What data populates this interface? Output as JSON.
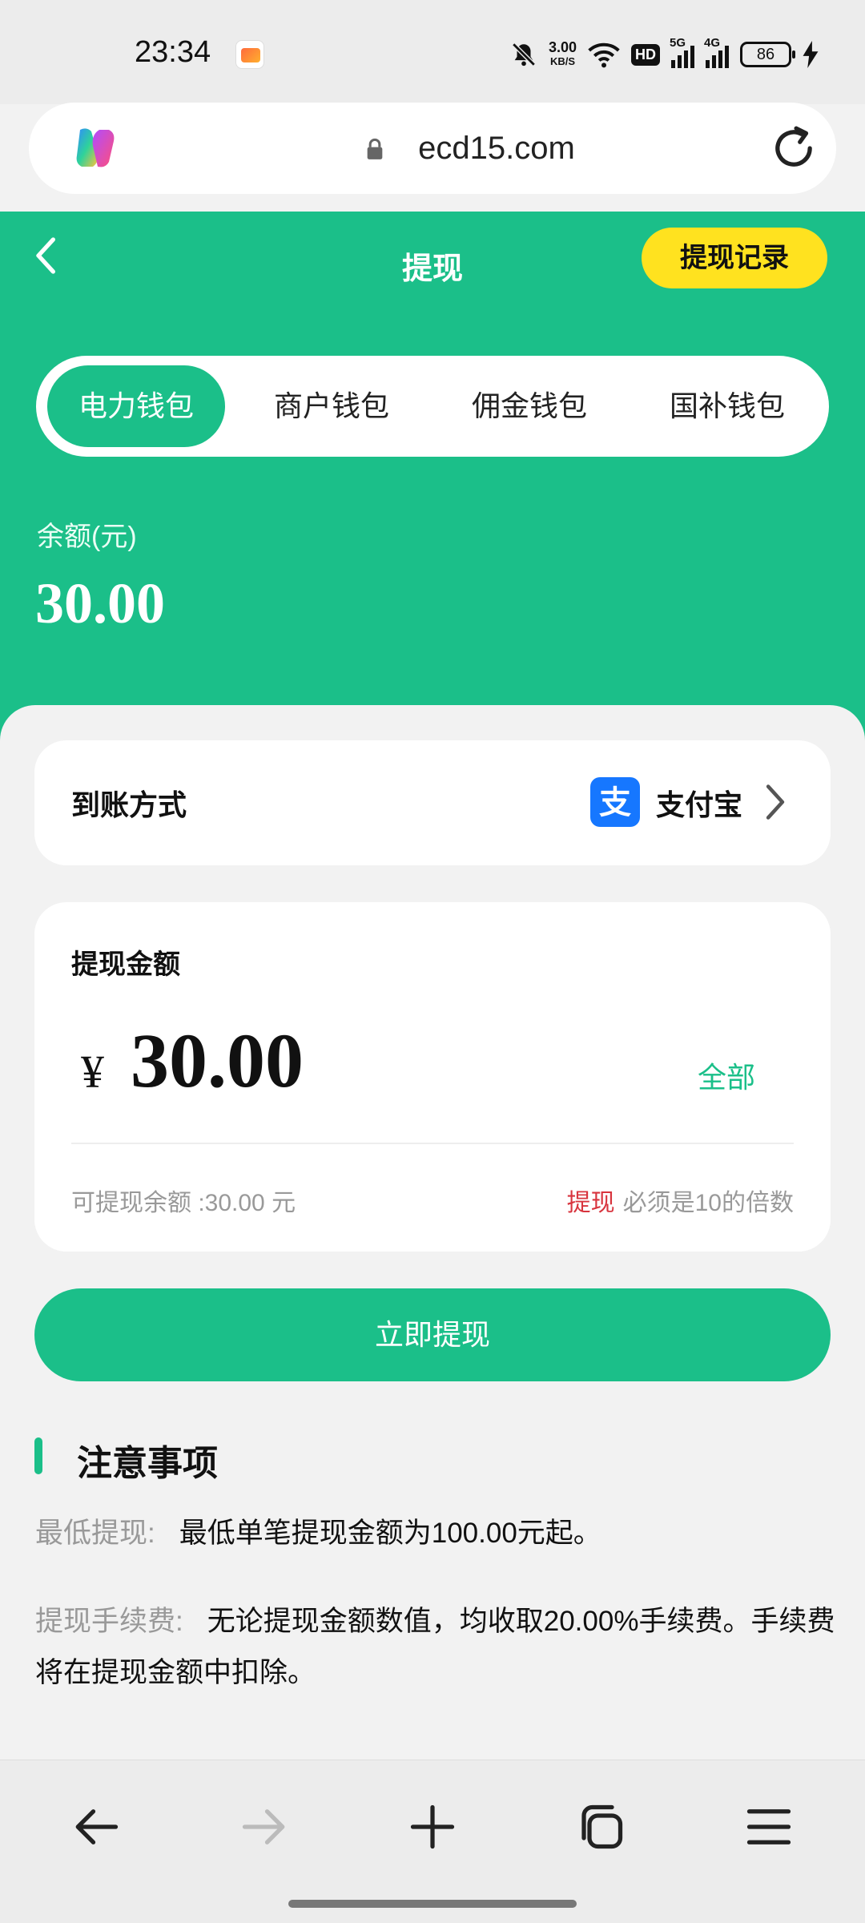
{
  "status_bar": {
    "time": "23:34",
    "net_speed_value": "3.00",
    "net_speed_unit": "KB/S",
    "hd_label": "HD",
    "signal_1": "5G",
    "signal_2": "4G",
    "battery": "86",
    "icons": [
      "bell-muted-icon",
      "wifi-icon",
      "hd-icon",
      "signal-5g-icon",
      "signal-4g-icon",
      "battery-icon",
      "charging-icon"
    ]
  },
  "browser": {
    "url": "ecd15.com",
    "toolbar_icons": [
      "back-arrow-icon",
      "forward-arrow-icon",
      "new-tab-plus-icon",
      "tabs-icon",
      "menu-icon"
    ]
  },
  "header": {
    "title": "提现",
    "record_button": "提现记录",
    "tabs": [
      {
        "label": "电力钱包",
        "active": true
      },
      {
        "label": "商户钱包",
        "active": false
      },
      {
        "label": "佣金钱包",
        "active": false
      },
      {
        "label": "国补钱包",
        "active": false
      }
    ],
    "balance_label": "余额(元)",
    "balance_value": "30.00"
  },
  "method": {
    "label": "到账方式",
    "value": "支付宝"
  },
  "amount": {
    "label": "提现金额",
    "currency": "¥",
    "value": "30.00",
    "all_button": "全部",
    "available": "可提现余额 :30.00 元",
    "rule_highlight": "提现",
    "rule_text": "必须是10的倍数"
  },
  "submit_label": "立即提现",
  "notes": {
    "title": "注意事项",
    "items": [
      {
        "key": "最低提现:",
        "text": "最低单笔提现金额为100.00元起。"
      },
      {
        "key": "提现手续费:",
        "text": "无论提现金额数值，均收取20.00%手续费。手续费将在提现金额中扣除。"
      }
    ]
  },
  "colors": {
    "brand_green": "#1bbf89",
    "record_yellow": "#ffe21f",
    "alipay_blue": "#1677ff",
    "rule_red": "#d8343e"
  }
}
